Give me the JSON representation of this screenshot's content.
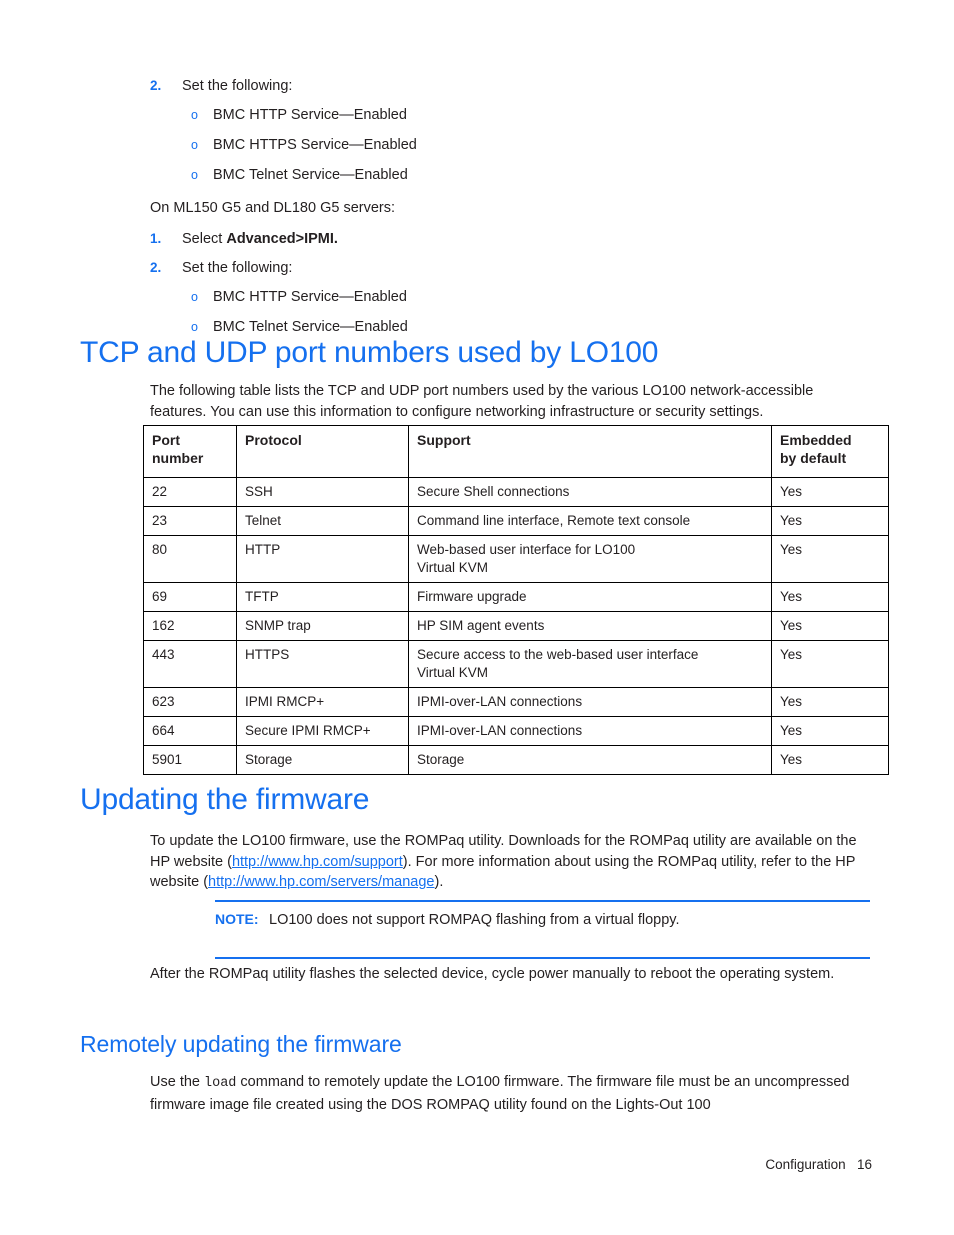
{
  "intro": {
    "step_top": {
      "number": "2.",
      "text": "Set the following:"
    },
    "bullets_top": [
      {
        "marker": "o",
        "text": "BMC HTTP Service—Enabled"
      },
      {
        "marker": "o",
        "text": "BMC HTTPS Service—Enabled"
      },
      {
        "marker": "o",
        "text": "BMC Telnet Service—Enabled"
      }
    ],
    "servers_line": "On ML150 G5 and DL180 G5 servers:",
    "steps": [
      {
        "number": "1.",
        "text_plain": "Select ",
        "text_bold": "Advanced>IPMI."
      },
      {
        "number": "2.",
        "text_plain": "Set the following:"
      }
    ],
    "bullets_bottom": [
      {
        "marker": "o",
        "text": "BMC HTTP Service—Enabled"
      },
      {
        "marker": "o",
        "text": "BMC Telnet Service—Enabled"
      }
    ]
  },
  "section_ports": {
    "heading": "TCP and UDP port numbers used by LO100",
    "paragraph": "The following table lists the TCP and UDP port numbers used by the various LO100 network-accessible features. You can use this information to configure networking infrastructure or security settings.",
    "table": {
      "headers": {
        "port": "Port\nnumber",
        "port_l1": "Port",
        "port_l2": "number",
        "protocol": "Protocol",
        "support": "Support",
        "embedded_l1": "Embedded",
        "embedded_l2": "by default"
      },
      "rows": [
        {
          "port": "22",
          "protocol": "SSH",
          "support_l1": "Secure Shell connections",
          "support_l2": "",
          "embedded": "Yes"
        },
        {
          "port": "23",
          "protocol": "Telnet",
          "support_l1": "Command line interface, Remote text console",
          "support_l2": "",
          "embedded": "Yes"
        },
        {
          "port": "80",
          "protocol": "HTTP",
          "support_l1": "Web-based user interface for LO100",
          "support_l2": "Virtual KVM",
          "embedded": "Yes"
        },
        {
          "port": "69",
          "protocol": "TFTP",
          "support_l1": "Firmware upgrade",
          "support_l2": "",
          "embedded": "Yes"
        },
        {
          "port": "162",
          "protocol": "SNMP trap",
          "support_l1": "HP SIM agent events",
          "support_l2": "",
          "embedded": "Yes"
        },
        {
          "port": "443",
          "protocol": "HTTPS",
          "support_l1": "Secure access to the web-based user interface",
          "support_l2": "Virtual KVM",
          "embedded": "Yes"
        },
        {
          "port": "623",
          "protocol": "IPMI RMCP+",
          "support_l1": "IPMI-over-LAN connections",
          "support_l2": "",
          "embedded": "Yes"
        },
        {
          "port": "664",
          "protocol": "Secure IPMI RMCP+",
          "support_l1": "IPMI-over-LAN connections",
          "support_l2": "",
          "embedded": "Yes"
        },
        {
          "port": "5901",
          "protocol": "Storage",
          "support_l1": "Storage",
          "support_l2": "",
          "embedded": "Yes"
        }
      ]
    }
  },
  "section_updating": {
    "heading": "Updating the firmware",
    "para_1a": "To update the LO100 firmware, use the ROMPaq utility. Downloads for the ROMPaq utility are available on the HP website (",
    "link_1": "http://www.hp.com/support",
    "para_1b": "). For more information about using the ROMPaq utility, refer to the HP website (",
    "link_2": "http://www.hp.com/servers/manage",
    "para_1c": ").",
    "note": {
      "label": "NOTE:",
      "text": "LO100 does not support ROMPAQ flashing from a virtual floppy."
    },
    "para_2": "After the ROMPaq utility flashes the selected device, cycle power manually to reboot the operating system."
  },
  "section_remote": {
    "heading": "Remotely updating the firmware",
    "para_a": "Use the ",
    "command": "load",
    "para_b": " command to remotely update the LO100 firmware. The firmware file must be an uncompressed firmware image file created using the DOS ROMPAQ utility found on the Lights-Out 100"
  },
  "footer": {
    "chapter": "Configuration",
    "page_number": "16"
  },
  "colors": {
    "accent_blue": "#1570ef",
    "body_text": "#231f20",
    "rule_black": "#000000"
  }
}
